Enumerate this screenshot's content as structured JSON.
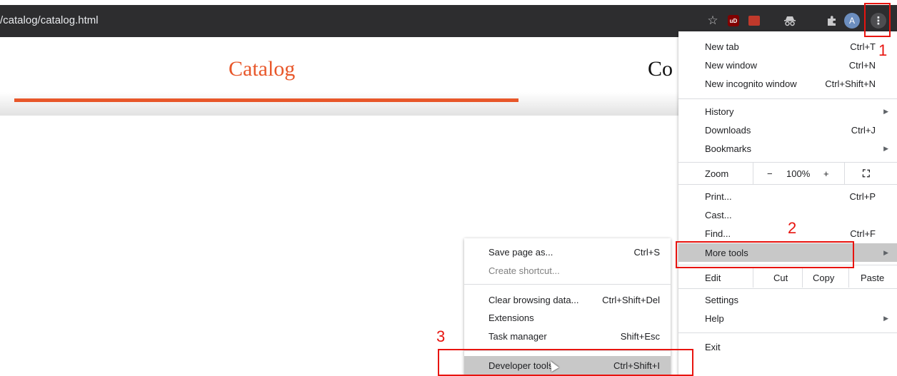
{
  "browser": {
    "url_text": "/catalog/catalog.html"
  },
  "page": {
    "catalog_heading": "Catalog",
    "partial_heading": "Co"
  },
  "main_menu": {
    "new_tab": {
      "label": "New tab",
      "shortcut": "Ctrl+T"
    },
    "new_window": {
      "label": "New window",
      "shortcut": "Ctrl+N"
    },
    "new_incognito": {
      "label": "New incognito window",
      "shortcut": "Ctrl+Shift+N"
    },
    "history": {
      "label": "History"
    },
    "downloads": {
      "label": "Downloads",
      "shortcut": "Ctrl+J"
    },
    "bookmarks": {
      "label": "Bookmarks"
    },
    "zoom": {
      "label": "Zoom",
      "minus": "−",
      "value": "100%",
      "plus": "+"
    },
    "print": {
      "label": "Print...",
      "shortcut": "Ctrl+P"
    },
    "cast": {
      "label": "Cast..."
    },
    "find": {
      "label": "Find...",
      "shortcut": "Ctrl+F"
    },
    "more_tools": {
      "label": "More tools"
    },
    "edit": {
      "label": "Edit",
      "cut": "Cut",
      "copy": "Copy",
      "paste": "Paste"
    },
    "settings": {
      "label": "Settings"
    },
    "help": {
      "label": "Help"
    },
    "exit": {
      "label": "Exit"
    }
  },
  "sub_menu": {
    "save_page": {
      "label": "Save page as...",
      "shortcut": "Ctrl+S"
    },
    "create_shortcut": {
      "label": "Create shortcut..."
    },
    "clear_browsing": {
      "label": "Clear browsing data...",
      "shortcut": "Ctrl+Shift+Del"
    },
    "extensions": {
      "label": "Extensions"
    },
    "task_manager": {
      "label": "Task manager",
      "shortcut": "Shift+Esc"
    },
    "developer_tools": {
      "label": "Developer tools",
      "shortcut": "Ctrl+Shift+I"
    }
  },
  "annotations": {
    "step1": "1",
    "step2": "2",
    "step3": "3"
  },
  "toolbar_icons": {
    "avatar_letter": "A",
    "ublock_text": "uD"
  },
  "colors": {
    "accent": "#e8572a",
    "annotation": "#e8140f",
    "toolbar_bg": "#2d2d2f"
  }
}
